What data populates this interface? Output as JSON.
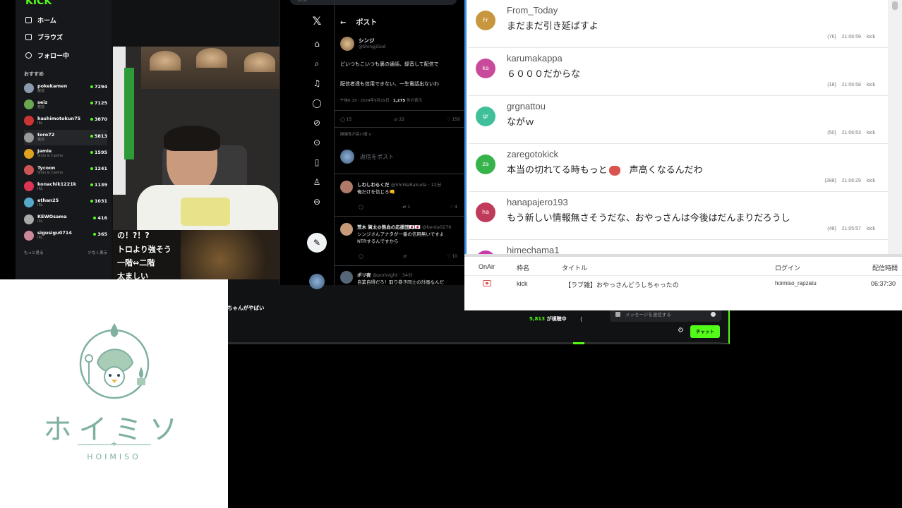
{
  "kick": {
    "logo": "KICK",
    "nav": [
      "ホーム",
      "ブラウズ",
      "フォロー中"
    ],
    "recommended_title": "おすすめ",
    "channels": [
      {
        "name": "pokekamen",
        "category": "雑談",
        "viewers": "7294",
        "color": "#8a9bb0"
      },
      {
        "name": "seiz",
        "category": "雑談",
        "viewers": "7125",
        "color": "#6aa84f"
      },
      {
        "name": "hashimotokun75",
        "category": "IRL",
        "viewers": "3870",
        "color": "#cc3333"
      },
      {
        "name": "toro72",
        "category": "雑談",
        "viewers": "5813",
        "color": "#999999"
      },
      {
        "name": "Jamie",
        "category": "Slots & Casino",
        "viewers": "1595",
        "color": "#e0a020"
      },
      {
        "name": "Tycoon",
        "category": "Slots & Casino",
        "viewers": "1241",
        "color": "#cc5555"
      },
      {
        "name": "konachik1221k",
        "category": "IRL",
        "viewers": "1139",
        "color": "#dd3355"
      },
      {
        "name": "ethan25",
        "category": "IRL",
        "viewers": "1031",
        "color": "#55aacc"
      },
      {
        "name": "KEWOsama",
        "category": "IRL",
        "viewers": "416",
        "color": "#aaaaaa"
      },
      {
        "name": "sigusigu0714",
        "category": "IRL",
        "viewers": "365",
        "color": "#cc8899"
      }
    ],
    "show_more": "もっと見る",
    "show_less": "少なく表示",
    "overlay_lines": [
      "の！?！?",
      "トロより強そう",
      "一階⇔二階",
      "太ましい"
    ],
    "stream_title": "ちゃんがやばい",
    "viewer_count": "5,813",
    "viewer_suffix": "が視聴中",
    "chat_placeholder": "メッセージを送信する",
    "chat_button": "チャット"
  },
  "x": {
    "search_placeholder": "検索",
    "header_title": "ポスト",
    "author_name": "シンジ",
    "author_handle": "@ShingjiGod",
    "post_lines": [
      "どいつもこいつも裏の通話、録音して配信で",
      "配信者達も信用できない、一生電話出ないわ"
    ],
    "post_meta_time": "午後6:19 · 2024年9月19日 · ",
    "post_meta_views": "1,275",
    "post_meta_suffix": " 件の表示",
    "actions": [
      "15",
      "22",
      "",
      "150",
      ""
    ],
    "more_link": "関連性が高い順 ∨",
    "reply_placeholder": "返信をポスト",
    "replies": [
      {
        "name": "しわしわらくだ",
        "handle": "@ShiWaRakuda · 12分",
        "text": "俺だけを信じろ👊",
        "color": "#b07a6a",
        "actions": [
          "",
          "1",
          "",
          "4"
        ]
      },
      {
        "name": "荒木 賀太@熱血の応援団🇯🇵🇯🇵",
        "handle": "@kenta0276",
        "text": "シンジさんアナタが一番の信用無いですよ",
        "text2": "NTRするんですから",
        "color": "#c79a7a",
        "actions": [
          "",
          "",
          "",
          "10"
        ]
      },
      {
        "name": "ポリ夜",
        "handle": "@porinight · 34分",
        "text": "自業自得だろ！取り巻き同士の計画なんだ",
        "color": "#556677"
      }
    ]
  },
  "comment_viewer": {
    "comments": [
      {
        "initials": "Fr",
        "user": "From_Today",
        "message": "まだまだ引き延ばすよ",
        "count": "(76)",
        "time": "21:06:59",
        "site": "kick",
        "color": "#c8963e"
      },
      {
        "initials": "ka",
        "user": "karumakappa",
        "message": "６０００だからな",
        "count": "(18)",
        "time": "21:06:58",
        "site": "kick",
        "color": "#c94a9a"
      },
      {
        "initials": "gr",
        "user": "grgnattou",
        "message": "ながｗ",
        "count": "(50)",
        "time": "21:06:53",
        "site": "kick",
        "color": "#3fbf9a"
      },
      {
        "initials": "za",
        "user": "zaregotokick",
        "message": "本当の切れてる時もっと",
        "message_tail": "　声高くなるんだわ",
        "count": "(388)",
        "time": "21:06:29",
        "site": "kick",
        "color": "#36b34a"
      },
      {
        "initials": "ha",
        "user": "hanapajero193",
        "message": "もう新しい情報無さそうだな、おやっさんは今後はだんまりだろうし",
        "count": "(48)",
        "time": "21:05:57",
        "site": "kick",
        "color": "#c03a5a"
      },
      {
        "initials": "hi",
        "user": "himechama1",
        "message": "",
        "count": "",
        "time": "",
        "site": "",
        "color": "#c83aa8"
      }
    ],
    "table_headers": [
      "OnAir",
      "枠名",
      "タイトル",
      "ログイン",
      "配信時間"
    ],
    "table_row": {
      "site": "kick",
      "title": "【ラブ雑】おやっさんどうしちゃったの",
      "login": "hoimiso_rapzatu",
      "duration": "06:37:30"
    }
  },
  "logo": {
    "kana": "ホイミソ",
    "roman": "HOIMISO",
    "color": "#7fb0a2"
  }
}
